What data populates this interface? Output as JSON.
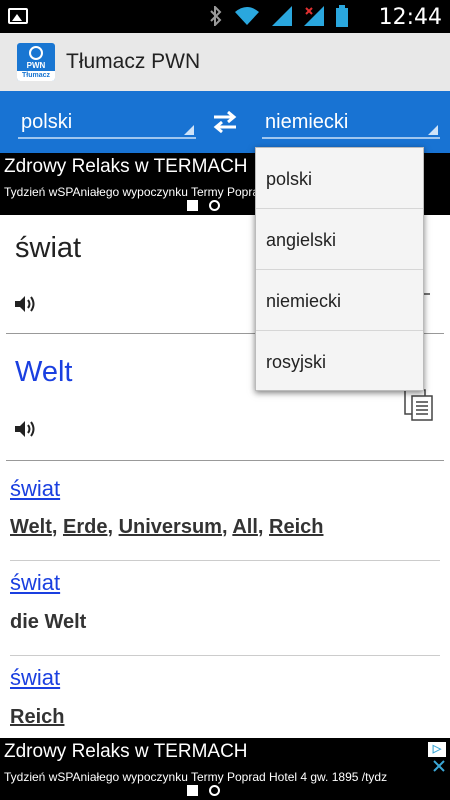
{
  "status_bar": {
    "time": "12:44",
    "icons": [
      "image-icon",
      "bluetooth-icon",
      "wifi-icon",
      "signal-icon",
      "signal-off-icon",
      "battery-icon"
    ]
  },
  "app": {
    "title": "Tłumacz PWN",
    "logo_text_top": "PWN",
    "logo_text_bottom": "Tłumacz"
  },
  "language_bar": {
    "source_language": "polski",
    "target_language": "niemiecki"
  },
  "ad_top": {
    "title": "Zdrowy Relaks w TERMACH",
    "subtitle": "Tydzień wSPAniałego wypoczynku Termy Poprad Hotel 4 gw. 1895 /tydz"
  },
  "ad_bottom": {
    "title": "Zdrowy Relaks w TERMACH",
    "subtitle": "Tydzień wSPAniałego wypoczynku Termy Poprad Hotel 4 gw. 1895 /tydz"
  },
  "translation": {
    "source_term": "świat",
    "target_term": "Welt"
  },
  "entries": [
    {
      "headword": "świat",
      "words": [
        "Welt",
        "Erde",
        "Universum",
        "All",
        "Reich"
      ]
    },
    {
      "headword": "świat",
      "words": [
        "die Welt"
      ]
    },
    {
      "headword": "świat",
      "words": [
        "Reich"
      ]
    }
  ],
  "dropdown": {
    "options": [
      "polski",
      "angielski",
      "niemiecki",
      "rosyjski"
    ]
  },
  "colors": {
    "language_bar": "#1873d3",
    "app_bar": "#e8e8e8",
    "link": "#1a3fe0",
    "ad_background": "#000000"
  }
}
